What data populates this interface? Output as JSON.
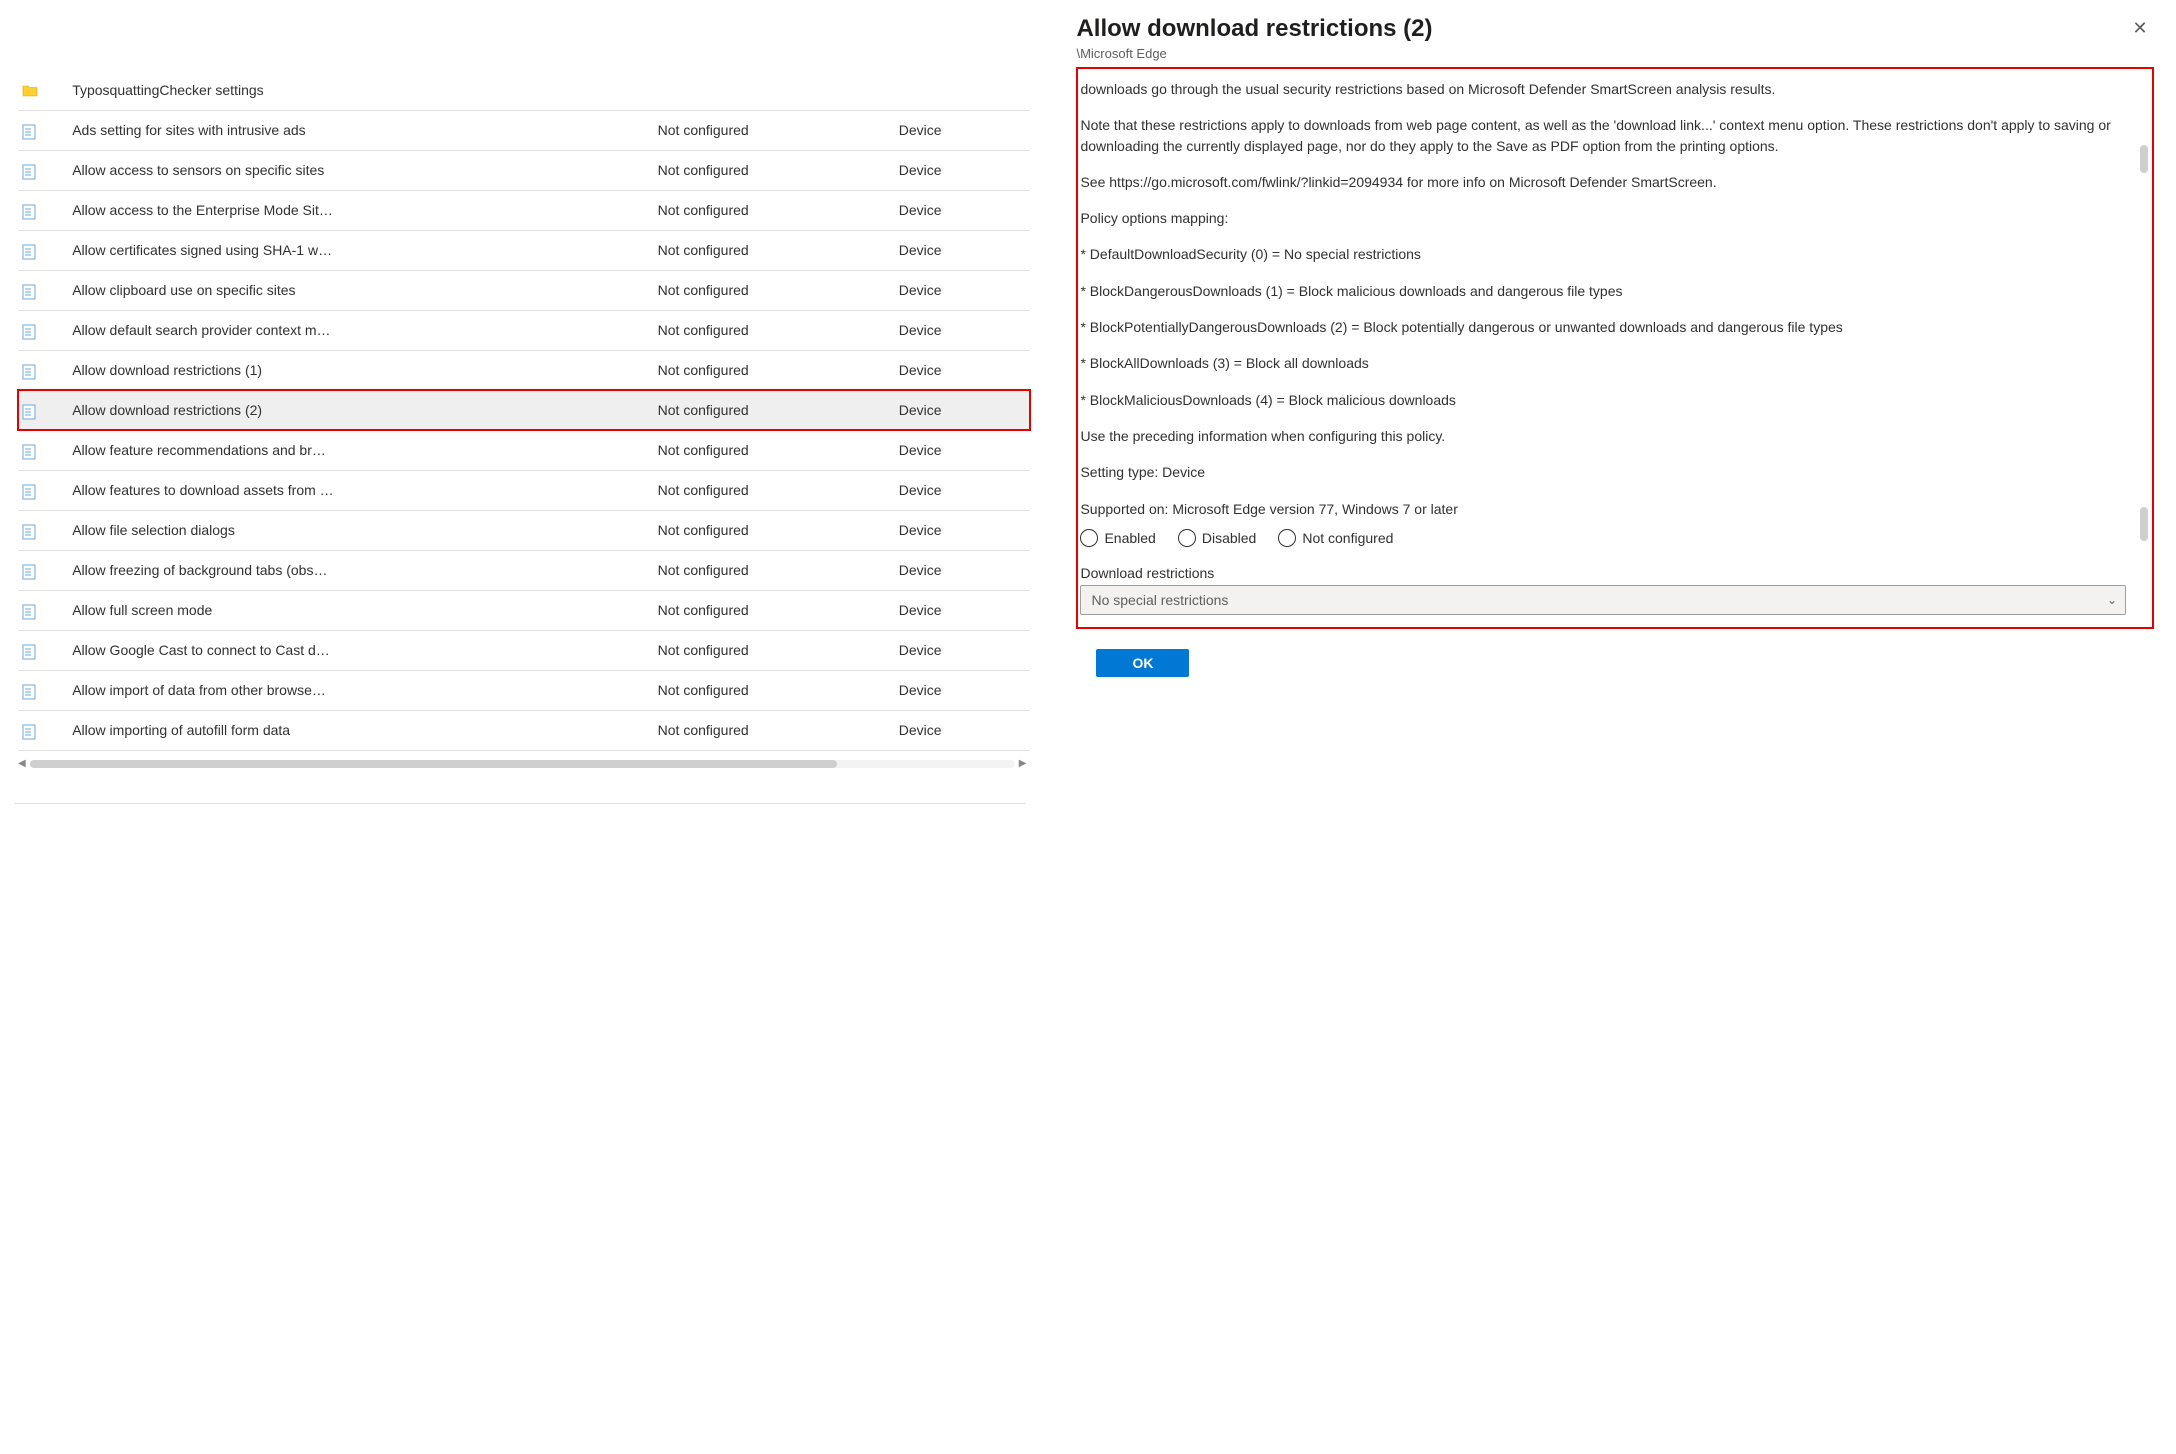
{
  "rows": [
    {
      "kind": "folder",
      "name": "TyposquattingChecker settings",
      "state": "",
      "scope": "",
      "selected": false
    },
    {
      "kind": "setting",
      "name": "Ads setting for sites with intrusive ads",
      "state": "Not configured",
      "scope": "Device",
      "selected": false
    },
    {
      "kind": "setting",
      "name": "Allow access to sensors on specific sites",
      "state": "Not configured",
      "scope": "Device",
      "selected": false
    },
    {
      "kind": "setting",
      "name": "Allow access to the Enterprise Mode Sit…",
      "state": "Not configured",
      "scope": "Device",
      "selected": false
    },
    {
      "kind": "setting",
      "name": "Allow certificates signed using SHA-1 w…",
      "state": "Not configured",
      "scope": "Device",
      "selected": false
    },
    {
      "kind": "setting",
      "name": "Allow clipboard use on specific sites",
      "state": "Not configured",
      "scope": "Device",
      "selected": false
    },
    {
      "kind": "setting",
      "name": "Allow default search provider context m…",
      "state": "Not configured",
      "scope": "Device",
      "selected": false
    },
    {
      "kind": "setting",
      "name": "Allow download restrictions (1)",
      "state": "Not configured",
      "scope": "Device",
      "selected": false
    },
    {
      "kind": "setting",
      "name": "Allow download restrictions (2)",
      "state": "Not configured",
      "scope": "Device",
      "selected": true
    },
    {
      "kind": "setting",
      "name": "Allow feature recommendations and br…",
      "state": "Not configured",
      "scope": "Device",
      "selected": false
    },
    {
      "kind": "setting",
      "name": "Allow features to download assets from …",
      "state": "Not configured",
      "scope": "Device",
      "selected": false
    },
    {
      "kind": "setting",
      "name": "Allow file selection dialogs",
      "state": "Not configured",
      "scope": "Device",
      "selected": false
    },
    {
      "kind": "setting",
      "name": "Allow freezing of background tabs (obs…",
      "state": "Not configured",
      "scope": "Device",
      "selected": false
    },
    {
      "kind": "setting",
      "name": "Allow full screen mode",
      "state": "Not configured",
      "scope": "Device",
      "selected": false
    },
    {
      "kind": "setting",
      "name": "Allow Google Cast to connect to Cast d…",
      "state": "Not configured",
      "scope": "Device",
      "selected": false
    },
    {
      "kind": "setting",
      "name": "Allow import of data from other browse…",
      "state": "Not configured",
      "scope": "Device",
      "selected": false
    },
    {
      "kind": "setting",
      "name": "Allow importing of autofill form data",
      "state": "Not configured",
      "scope": "Device",
      "selected": false
    }
  ],
  "detail": {
    "title": "Allow download restrictions (2)",
    "path": "\\Microsoft Edge",
    "paragraphs": [
      "downloads go through the usual security restrictions based on Microsoft Defender SmartScreen analysis results.",
      "Note that these restrictions apply to downloads from web page content, as well as the 'download link...' context menu option. These restrictions don't apply to saving or downloading the currently displayed page, nor do they apply to the Save as PDF option from the printing options.",
      "See https://go.microsoft.com/fwlink/?linkid=2094934 for more info on Microsoft Defender SmartScreen.",
      "Policy options mapping:",
      "* DefaultDownloadSecurity (0) = No special restrictions",
      "* BlockDangerousDownloads (1) = Block malicious downloads and dangerous file types",
      "* BlockPotentiallyDangerousDownloads (2) = Block potentially dangerous or unwanted downloads and dangerous file types",
      "* BlockAllDownloads (3) = Block all downloads",
      "* BlockMaliciousDownloads (4) = Block malicious downloads",
      "Use the preceding information when configuring this policy.",
      "Setting type: Device",
      "Supported on: Microsoft Edge version 77, Windows 7 or later"
    ],
    "radio_options": [
      "Enabled",
      "Disabled",
      "Not configured"
    ],
    "dropdown_label": "Download restrictions",
    "dropdown_value": "No special restrictions",
    "ok_label": "OK"
  }
}
